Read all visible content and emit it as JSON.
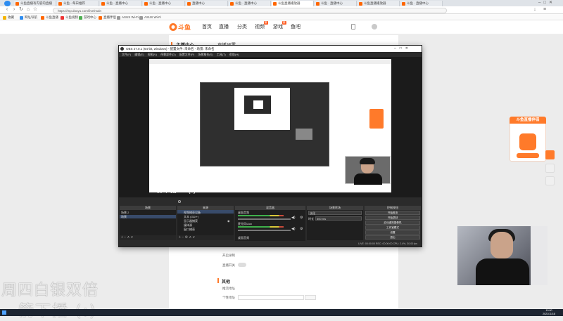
{
  "browser": {
    "tabs": [
      "斗鱼直播有内容的直播",
      "斗鱼 - 每日推荐",
      "斗鱼 · 直播中心",
      "斗鱼 · 直播中心",
      "直播中心",
      "斗鱼 · 直播中心",
      "斗鱼直播播放器",
      "斗鱼 · 直播中心",
      "斗鱼直播播放器",
      "斗鱼 · 直播中心"
    ],
    "active_tab_index": 6,
    "url": "https://mp.douyu.com/live/main",
    "bookmarks": [
      "收藏",
      "网址导航",
      "斗鱼直播",
      "斗鱼视频",
      "游戏中心",
      "直播伴侣",
      "ASUS Wi-Fi",
      "ASUS Wi-Fi"
    ]
  },
  "site": {
    "logo_text": "斗鱼",
    "nav": [
      "首页",
      "直播",
      "分类",
      "视频",
      "游戏",
      "鱼吧"
    ],
    "badge_video": "新",
    "badge_game": "新"
  },
  "page": {
    "sidebar_title": "主播中心",
    "content_title": "直播设置",
    "rightcard_title": "斗鱼直播伴侣",
    "form_labels": [
      "开启录制",
      "直播开关",
      "推流地址",
      "个性地址"
    ],
    "section_link": "其他"
  },
  "obs": {
    "title": "OBS 27.0.1 (64-bit, windows) - 配置文件: 未命名 - 场景: 未命名",
    "menu": "文件(F) 编辑(E) 视图(V) 停靠部件(D) 配置文件(P) 场景集合(S) 工具(T) 帮助(H)",
    "preview_overlay": "一箭下播 ⟳ (:)",
    "docks": {
      "scenes": {
        "title": "场景",
        "items": [
          "场景 2",
          "场景"
        ]
      },
      "sources": {
        "title": "来源",
        "items": [
          "视频捕获设备",
          "文本 (GDI+)",
          "显示器捕获",
          "媒体源",
          "窗口捕获"
        ]
      },
      "mixer": {
        "title": "混音器",
        "tracks": [
          "桌面音频",
          "麦克风/Aux",
          "桌面音频"
        ]
      },
      "transitions": {
        "title": "场景转场",
        "type": "淡化",
        "duration_label": "时长",
        "duration": "300 ms"
      },
      "controls": {
        "title": "控制按钮",
        "buttons": [
          "开始推流",
          "开始录制",
          "启动虚拟摄像机",
          "工作室模式",
          "设置",
          "退出"
        ]
      }
    },
    "status": "LIVE: 00:00:00   REC: 00:00:00   CPU: 2.4%, 30.00 fps"
  },
  "overlay": {
    "line1": "周四白银双倍",
    "line2": "一箭下播 (:)"
  },
  "taskbar": {
    "time": "19:00",
    "date": "2021/11/18"
  }
}
